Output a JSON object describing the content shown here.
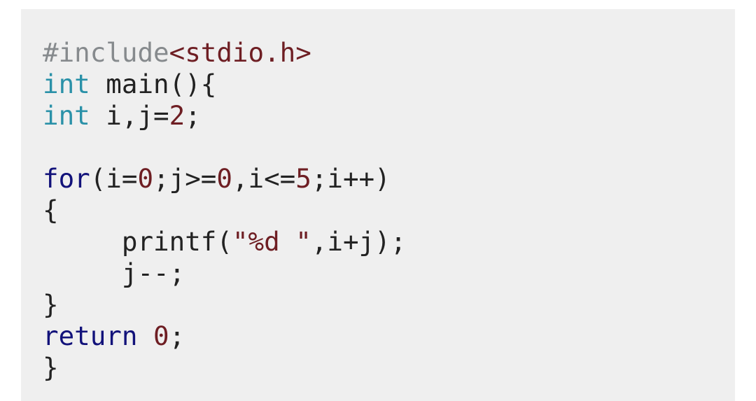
{
  "colors": {
    "background": "#efefef",
    "plain": "#222222",
    "preprocessor": "#868a8d",
    "type_keyword": "#2a91a8",
    "control_keyword": "#12127a",
    "literal": "#6e1e23"
  },
  "code_lines": [
    [
      {
        "text": "#include",
        "kind": "preprocessor"
      },
      {
        "text": "<stdio.h>",
        "kind": "literal"
      }
    ],
    [
      {
        "text": "int",
        "kind": "type_keyword"
      },
      {
        "text": " main(){",
        "kind": "plain"
      }
    ],
    [
      {
        "text": "int",
        "kind": "type_keyword"
      },
      {
        "text": " i,j=",
        "kind": "plain"
      },
      {
        "text": "2",
        "kind": "literal"
      },
      {
        "text": ";",
        "kind": "plain"
      }
    ],
    [],
    [
      {
        "text": "for",
        "kind": "control_keyword"
      },
      {
        "text": "(i=",
        "kind": "plain"
      },
      {
        "text": "0",
        "kind": "literal"
      },
      {
        "text": ";j>=",
        "kind": "plain"
      },
      {
        "text": "0",
        "kind": "literal"
      },
      {
        "text": ",i<=",
        "kind": "plain"
      },
      {
        "text": "5",
        "kind": "literal"
      },
      {
        "text": ";i++)",
        "kind": "plain"
      }
    ],
    [
      {
        "text": "{",
        "kind": "plain"
      }
    ],
    [
      {
        "text": "     printf(",
        "kind": "plain"
      },
      {
        "text": "\"%d \"",
        "kind": "literal"
      },
      {
        "text": ",i+j);",
        "kind": "plain"
      }
    ],
    [
      {
        "text": "     j--;",
        "kind": "plain"
      }
    ],
    [
      {
        "text": "}",
        "kind": "plain"
      }
    ],
    [
      {
        "text": "return",
        "kind": "control_keyword"
      },
      {
        "text": " ",
        "kind": "plain"
      },
      {
        "text": "0",
        "kind": "literal"
      },
      {
        "text": ";",
        "kind": "plain"
      }
    ],
    [
      {
        "text": "}",
        "kind": "plain"
      }
    ]
  ]
}
